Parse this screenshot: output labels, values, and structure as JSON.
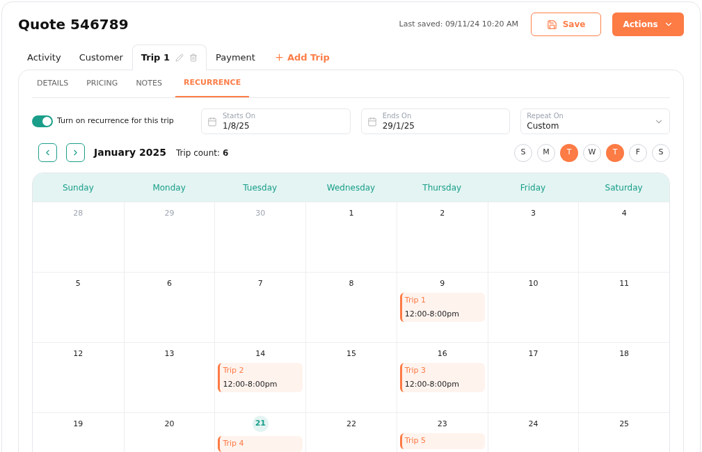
{
  "title": "Quote 546789",
  "last_saved": "Last saved: 09/11/24 10:20 AM",
  "save_button": "Save",
  "actions_button": "Actions",
  "tabs": [
    {
      "label": "Activity",
      "selected": false,
      "editable": false
    },
    {
      "label": "Customer",
      "selected": false,
      "editable": false
    },
    {
      "label": "Trip 1",
      "selected": true,
      "editable": true
    },
    {
      "label": "Payment",
      "selected": false,
      "editable": false
    }
  ],
  "add_trip": "Add Trip",
  "subtabs": [
    {
      "label": "DETAILS",
      "selected": false
    },
    {
      "label": "PRICING",
      "selected": false
    },
    {
      "label": "NOTES",
      "selected": false
    },
    {
      "label": "RECURRENCE",
      "selected": true
    }
  ],
  "recurrence_toggle": {
    "label": "Turn on recurrence for this trip",
    "on": true
  },
  "starts_on": {
    "label": "Starts On",
    "value": "1/8/25"
  },
  "ends_on": {
    "label": "Ends On",
    "value": "29/1/25"
  },
  "repeat_on": {
    "label": "Repeat On",
    "value": "Custom"
  },
  "month": "January 2025",
  "trip_count_label": "Trip count:",
  "trip_count": "6",
  "weekday_picker": [
    {
      "label": "S",
      "selected": false
    },
    {
      "label": "M",
      "selected": false
    },
    {
      "label": "T",
      "selected": true
    },
    {
      "label": "W",
      "selected": false
    },
    {
      "label": "T",
      "selected": true
    },
    {
      "label": "F",
      "selected": false
    },
    {
      "label": "S",
      "selected": false
    }
  ],
  "calendar": {
    "columns": [
      "Sunday",
      "Monday",
      "Tuesday",
      "Wednesday",
      "Thursday",
      "Friday",
      "Saturday"
    ],
    "weeks": [
      [
        {
          "day": "28",
          "muted": true,
          "today": false
        },
        {
          "day": "29",
          "muted": true,
          "today": false
        },
        {
          "day": "30",
          "muted": true,
          "today": false
        },
        {
          "day": "1",
          "muted": false,
          "today": false
        },
        {
          "day": "2",
          "muted": false,
          "today": false
        },
        {
          "day": "3",
          "muted": false,
          "today": false
        },
        {
          "day": "4",
          "muted": false,
          "today": false
        }
      ],
      [
        {
          "day": "5",
          "muted": false,
          "today": false
        },
        {
          "day": "6",
          "muted": false,
          "today": false
        },
        {
          "day": "7",
          "muted": false,
          "today": false
        },
        {
          "day": "8",
          "muted": false,
          "today": false
        },
        {
          "day": "9",
          "muted": false,
          "today": false,
          "events": [
            {
              "title": "Trip 1",
              "time": "12:00-8:00pm"
            }
          ]
        },
        {
          "day": "10",
          "muted": false,
          "today": false
        },
        {
          "day": "11",
          "muted": false,
          "today": false
        }
      ],
      [
        {
          "day": "12",
          "muted": false,
          "today": false
        },
        {
          "day": "13",
          "muted": false,
          "today": false
        },
        {
          "day": "14",
          "muted": false,
          "today": false,
          "events": [
            {
              "title": "Trip 2",
              "time": "12:00-8:00pm"
            }
          ]
        },
        {
          "day": "15",
          "muted": false,
          "today": false
        },
        {
          "day": "16",
          "muted": false,
          "today": false,
          "events": [
            {
              "title": "Trip 3",
              "time": "12:00-8:00pm"
            }
          ]
        },
        {
          "day": "17",
          "muted": false,
          "today": false
        },
        {
          "day": "18",
          "muted": false,
          "today": false
        }
      ],
      [
        {
          "day": "19",
          "muted": false,
          "today": false
        },
        {
          "day": "20",
          "muted": false,
          "today": false
        },
        {
          "day": "21",
          "muted": false,
          "today": true,
          "events": [
            {
              "title": "Trip 4"
            }
          ]
        },
        {
          "day": "22",
          "muted": false,
          "today": false
        },
        {
          "day": "23",
          "muted": false,
          "today": false,
          "events": [
            {
              "title": "Trip 5"
            }
          ]
        },
        {
          "day": "24",
          "muted": false,
          "today": false
        },
        {
          "day": "25",
          "muted": false,
          "today": false
        }
      ]
    ]
  }
}
